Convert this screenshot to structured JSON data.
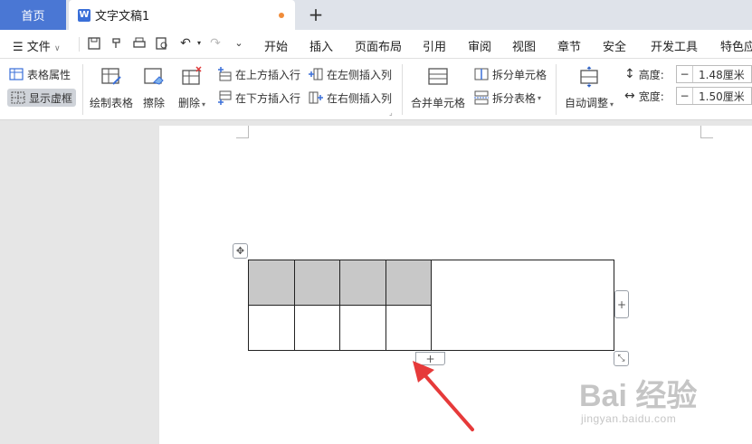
{
  "tabs": {
    "home": "首页",
    "doc_title": "文字文稿1",
    "logo_letter": "W",
    "add": "+"
  },
  "menu": {
    "file": "文件",
    "items": [
      "开始",
      "插入",
      "页面布局",
      "引用",
      "审阅",
      "视图",
      "章节",
      "安全",
      "开发工具",
      "特色应"
    ]
  },
  "ribbon": {
    "table_props": "表格属性",
    "show_grid": "显示虚框",
    "draw_table": "绘制表格",
    "erase": "擦除",
    "delete": "删除",
    "insert_above": "在上方插入行",
    "insert_below": "在下方插入行",
    "insert_left": "在左侧插入列",
    "insert_right": "在右侧插入列",
    "merge_cells": "合并单元格",
    "split_cells": "拆分单元格",
    "split_table": "拆分表格",
    "auto_fit": "自动调整",
    "height_label": "高度:",
    "width_label": "宽度:",
    "height_value": "1.48厘米",
    "width_value": "1.50厘米",
    "minus": "−"
  },
  "table": {
    "rows": 2,
    "shaded_cells": 4,
    "add_row_handle": "+",
    "add_col_handle": "+"
  },
  "watermark": {
    "brand": "Bai  经验",
    "url": "jingyan.baidu.com"
  },
  "colors": {
    "home_tab": "#4a77d4",
    "arrow": "#e63a3a",
    "shaded_cell": "#c8c8c8"
  }
}
